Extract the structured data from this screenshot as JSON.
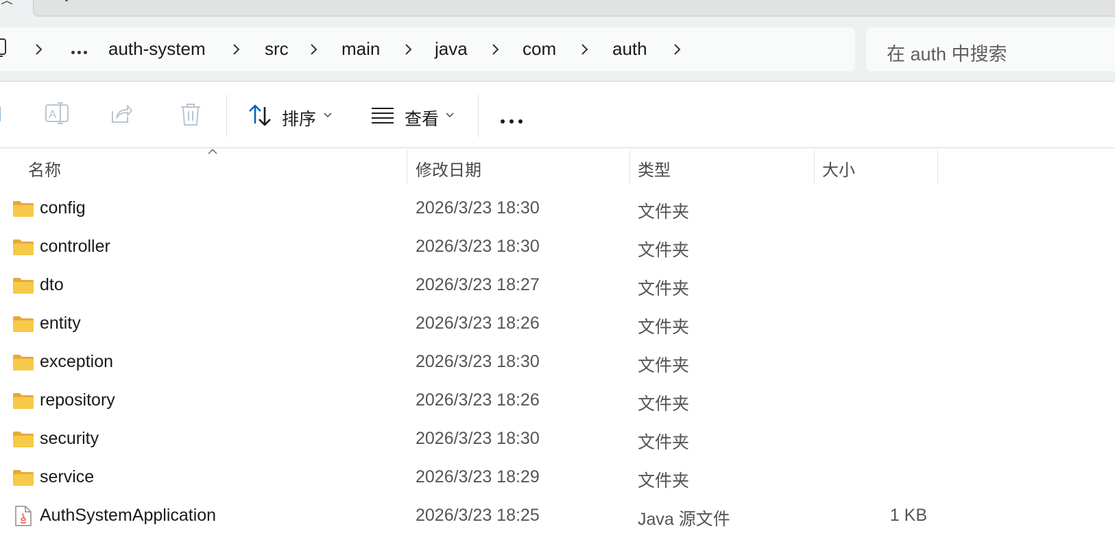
{
  "breadcrumb": {
    "items": [
      "auth-system",
      "src",
      "main",
      "java",
      "com",
      "auth"
    ],
    "overflow": "..."
  },
  "search": {
    "placeholder": "在 auth 中搜索"
  },
  "toolbar": {
    "sort_label": "排序",
    "view_label": "查看"
  },
  "columns": {
    "name": "名称",
    "modified": "修改日期",
    "type": "类型",
    "size": "大小"
  },
  "files": [
    {
      "name": "config",
      "modified": "2026/3/23 18:30",
      "type": "文件夹",
      "size": "",
      "icon": "folder-icon"
    },
    {
      "name": "controller",
      "modified": "2026/3/23 18:30",
      "type": "文件夹",
      "size": "",
      "icon": "folder-icon"
    },
    {
      "name": "dto",
      "modified": "2026/3/23 18:27",
      "type": "文件夹",
      "size": "",
      "icon": "folder-icon"
    },
    {
      "name": "entity",
      "modified": "2026/3/23 18:26",
      "type": "文件夹",
      "size": "",
      "icon": "folder-icon"
    },
    {
      "name": "exception",
      "modified": "2026/3/23 18:30",
      "type": "文件夹",
      "size": "",
      "icon": "folder-icon"
    },
    {
      "name": "repository",
      "modified": "2026/3/23 18:26",
      "type": "文件夹",
      "size": "",
      "icon": "folder-icon"
    },
    {
      "name": "security",
      "modified": "2026/3/23 18:30",
      "type": "文件夹",
      "size": "",
      "icon": "folder-icon"
    },
    {
      "name": "service",
      "modified": "2026/3/23 18:29",
      "type": "文件夹",
      "size": "",
      "icon": "folder-icon"
    },
    {
      "name": "AuthSystemApplication",
      "modified": "2026/3/23 18:25",
      "type": "Java 源文件",
      "size": "1 KB",
      "icon": "java-file-icon"
    }
  ],
  "colors": {
    "folder": "#f7c948",
    "folder_dark": "#e8a93a",
    "accent": "#0067c0",
    "disabled_icon": "#b9c6d3"
  }
}
